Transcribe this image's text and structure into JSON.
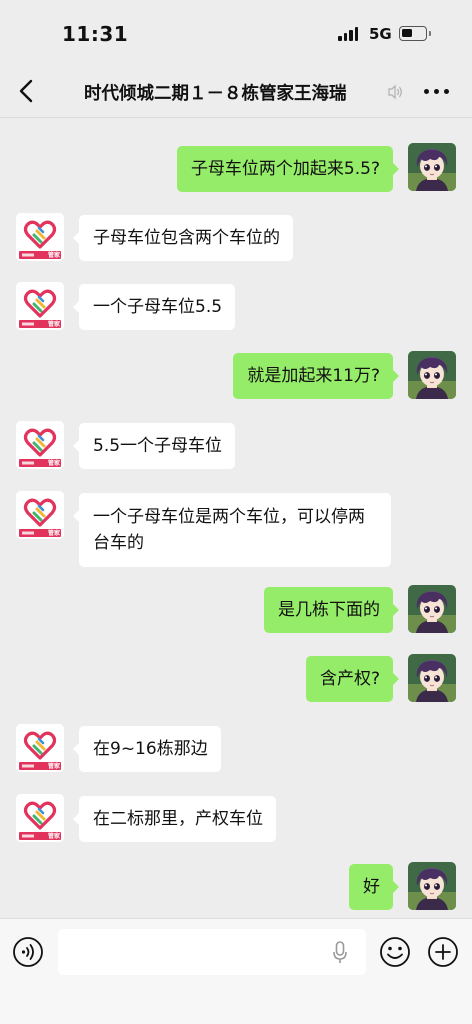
{
  "status_bar": {
    "time": "11:31",
    "network": "5G"
  },
  "nav": {
    "title": "时代倾城二期１－８栋管家王海瑞"
  },
  "brand_badge": {
    "tag": "管家"
  },
  "messages": [
    {
      "side": "out",
      "text": "子母车位两个加起来5.5?"
    },
    {
      "side": "in",
      "text": "子母车位包含两个车位的"
    },
    {
      "side": "in",
      "text": "一个子母车位5.5"
    },
    {
      "side": "out",
      "text": "就是加起来11万?"
    },
    {
      "side": "in",
      "text": "5.5一个子母车位"
    },
    {
      "side": "in",
      "text": "一个子母车位是两个车位，可以停两台车的"
    },
    {
      "side": "out",
      "text": "是几栋下面的"
    },
    {
      "side": "out",
      "text": "含产权?"
    },
    {
      "side": "in",
      "text": "在9~16栋那边"
    },
    {
      "side": "in",
      "text": "在二标那里，产权车位"
    },
    {
      "side": "out",
      "text": "好"
    }
  ],
  "icons": {
    "back": "chevron-left-icon",
    "speaker": "speaker-icon",
    "more": "more-dots-icon",
    "voice": "voice-input-icon",
    "mic": "mic-icon",
    "emoji": "emoji-icon",
    "plus": "plus-icon"
  },
  "colors": {
    "background": "#ededed",
    "outgoing_bubble": "#95ec69",
    "incoming_bubble": "#ffffff",
    "brand_heart": "#e2335c"
  }
}
